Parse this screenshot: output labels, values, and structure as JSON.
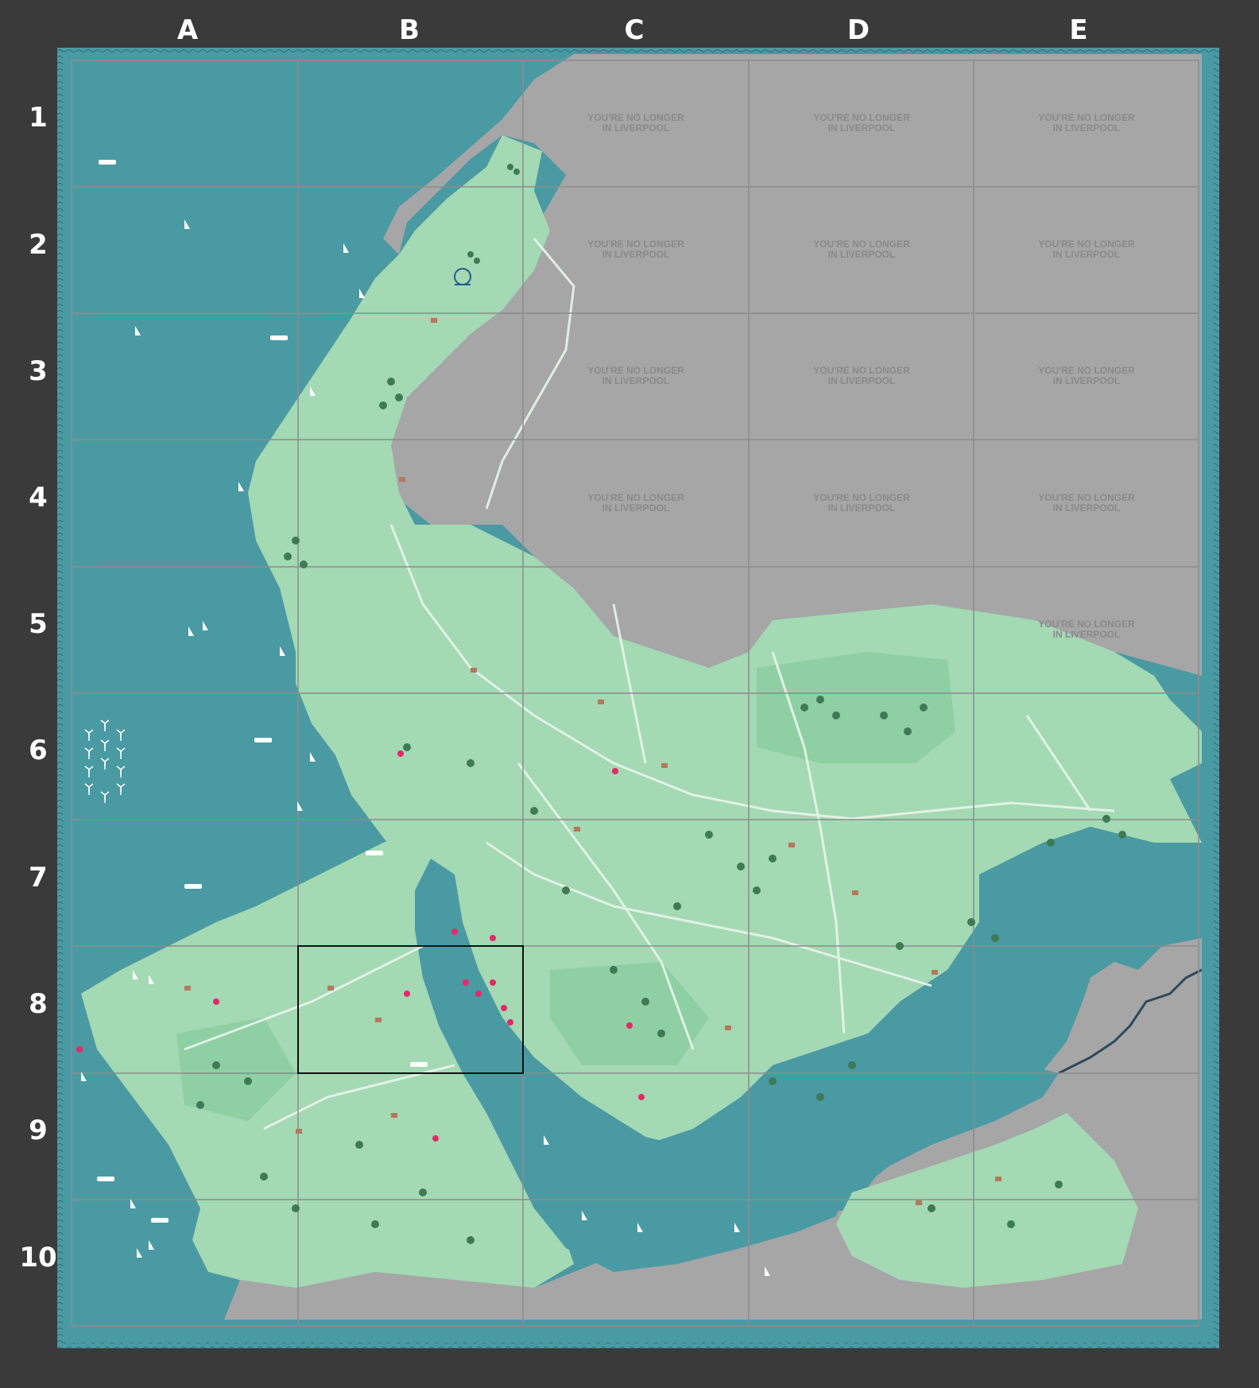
{
  "columns": [
    "A",
    "B",
    "C",
    "D",
    "E"
  ],
  "rows": [
    "1",
    "2",
    "3",
    "4",
    "5",
    "6",
    "7",
    "8",
    "9",
    "10"
  ],
  "outside_notice": {
    "line1": "YOU'RE NO LONGER",
    "line2": "IN LIVERPOOL",
    "cells": [
      "C1",
      "D1",
      "E1",
      "C2",
      "D2",
      "E2",
      "C3",
      "D3",
      "E3",
      "C4",
      "D4",
      "E4",
      "E5"
    ]
  },
  "highlighted_cell": "B8",
  "colors": {
    "background": "#3a3a3a",
    "sea": "#4a9aa3",
    "land": "#a3d9b3",
    "land_dark": "#8fcfa4",
    "outside": "#a6a6a6",
    "grid": "#8c8c8c",
    "river": "#4a9aa3"
  },
  "icons": [
    "wind-turbine-icon",
    "sailboat-icon",
    "ferry-icon",
    "tree-icon",
    "house-icon",
    "pin-icon",
    "ferris-wheel-icon"
  ]
}
